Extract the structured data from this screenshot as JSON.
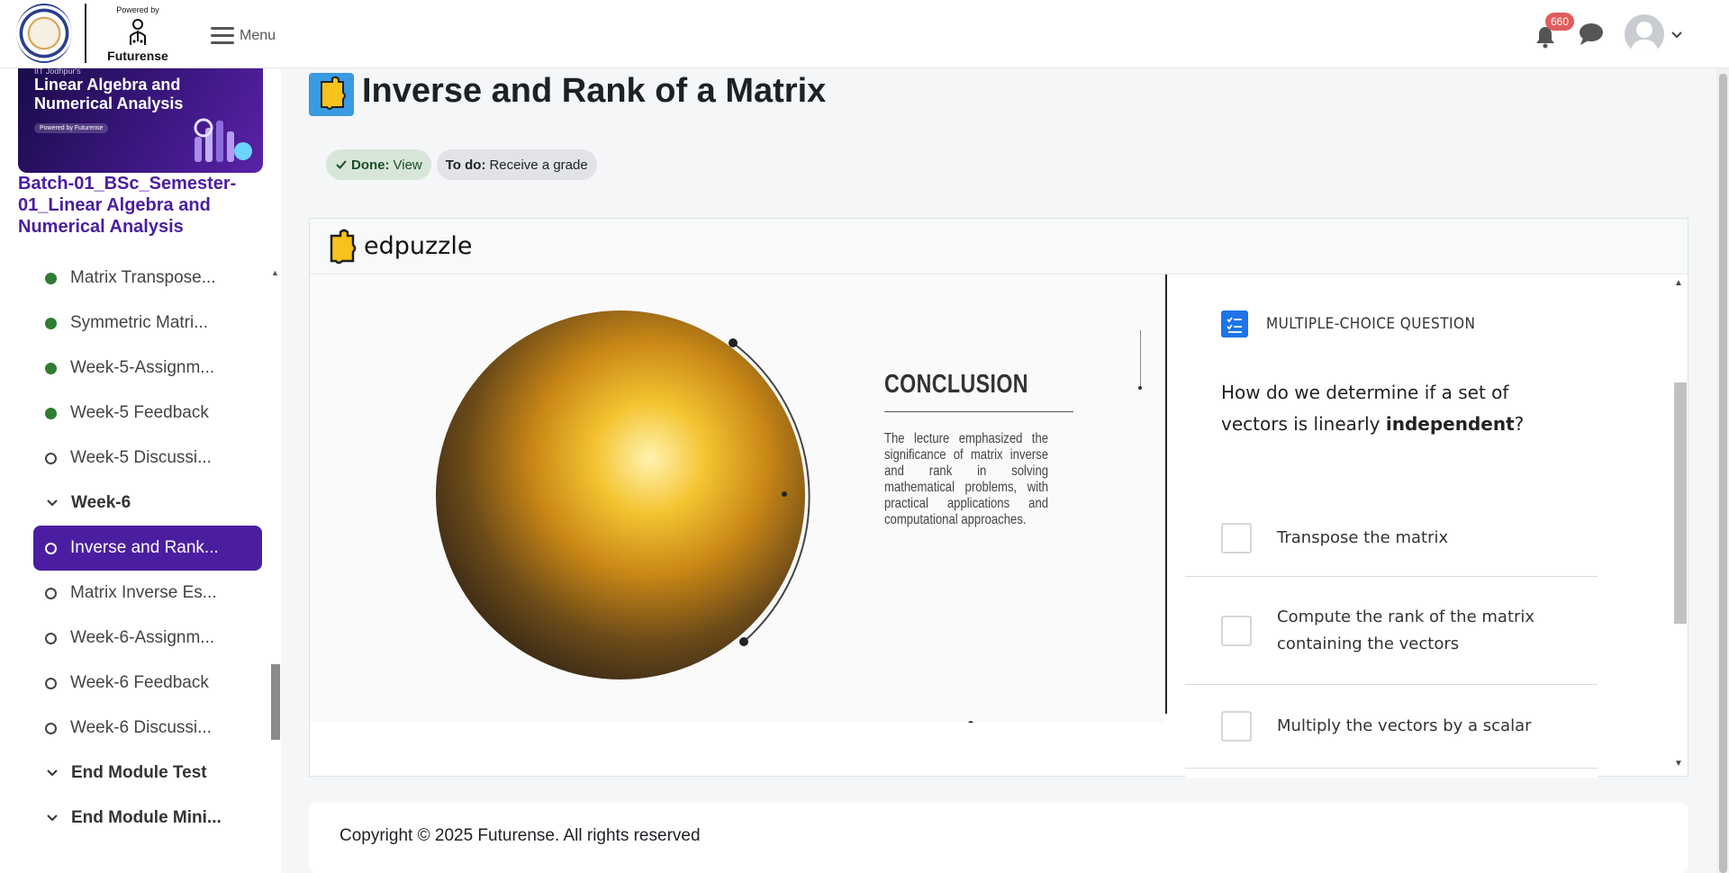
{
  "header": {
    "powered_by": "Powered by",
    "brand": "Futurense",
    "menu_label": "Menu",
    "notification_count": "660"
  },
  "sidebar": {
    "banner": {
      "small_text": "IIT Jodhpur's",
      "title": "Linear Algebra and Numerical Analysis",
      "pill": "Powered by Futurense"
    },
    "course_name": "Batch-01_BSc_Semester-01_Linear Algebra and Numerical Analysis",
    "items": [
      {
        "label": "Matrix Transpose...",
        "status": "done"
      },
      {
        "label": "Symmetric Matri...",
        "status": "done"
      },
      {
        "label": "Week-5-Assignm...",
        "status": "done"
      },
      {
        "label": "Week-5 Feedback",
        "status": "done"
      },
      {
        "label": "Week-5 Discussi...",
        "status": "todo"
      },
      {
        "label": "Week-6",
        "status": "section"
      },
      {
        "label": "Inverse and Rank...",
        "status": "active"
      },
      {
        "label": "Matrix Inverse Es...",
        "status": "todo"
      },
      {
        "label": "Week-6-Assignm...",
        "status": "todo"
      },
      {
        "label": "Week-6 Feedback",
        "status": "todo"
      },
      {
        "label": "Week-6 Discussi...",
        "status": "todo"
      },
      {
        "label": "End Module Test",
        "status": "section"
      },
      {
        "label": "End Module Mini...",
        "status": "section"
      }
    ]
  },
  "page": {
    "title": "Inverse and Rank of a Matrix",
    "completion": {
      "done_label": "Done:",
      "done_value": "View",
      "todo_label": "To do:",
      "todo_value": "Receive a grade"
    }
  },
  "edpuzzle": {
    "brand": "edpuzzle",
    "slide": {
      "heading": "CONCLUSION",
      "body": "The lecture emphasized the significance of matrix inverse and rank in solving mathematical problems, with practical applications and computational approaches."
    },
    "question": {
      "type_label": "MULTIPLE-CHOICE QUESTION",
      "text_before": "How do we determine if a set of vectors is linearly ",
      "text_bold": "independent",
      "text_after": "?",
      "options": [
        "Transpose the matrix",
        "Compute the rank of the matrix containing the vectors",
        "Multiply the vectors by a scalar"
      ]
    }
  },
  "footer": {
    "copyright": "Copyright © 2025 Futurense. All rights reserved"
  },
  "colors": {
    "brand_purple": "#4b1ea1",
    "done_green": "#2e7d32",
    "badge_red": "#e05d5d",
    "edpuzzle_blue": "#1e74e8",
    "page_icon_blue": "#399be2"
  }
}
